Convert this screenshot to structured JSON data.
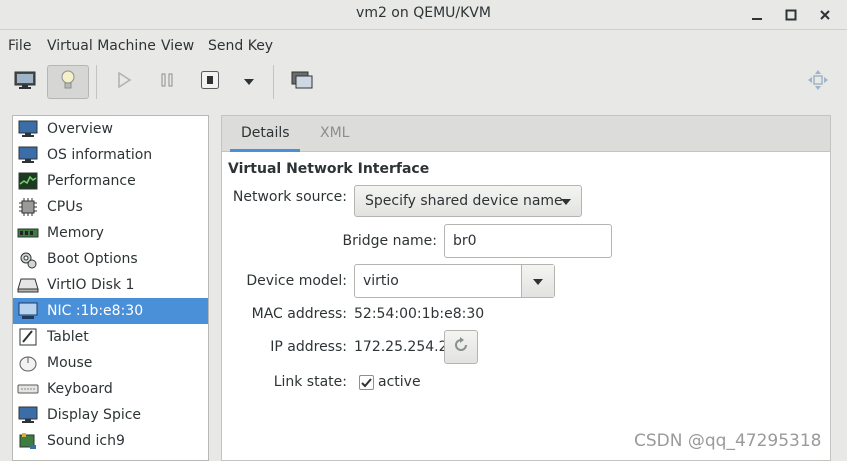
{
  "window": {
    "title": "vm2 on QEMU/KVM",
    "controls": [
      "minimize-icon",
      "maximize-icon",
      "close-icon"
    ]
  },
  "menubar": {
    "items": [
      "File",
      "Virtual Machine",
      "View",
      "Send Key"
    ]
  },
  "toolbar": {
    "buttons": [
      "monitor-icon",
      "lightbulb-icon",
      "play-icon",
      "pause-icon",
      "stop-icon",
      "chevron-down-icon",
      "screenshot-icon",
      "fullscreen-icon"
    ],
    "active": "lightbulb-icon"
  },
  "sidebar": {
    "items": [
      {
        "label": "Overview",
        "icon": "overview-icon"
      },
      {
        "label": "OS information",
        "icon": "os-info-icon"
      },
      {
        "label": "Performance",
        "icon": "performance-icon"
      },
      {
        "label": "CPUs",
        "icon": "cpu-icon"
      },
      {
        "label": "Memory",
        "icon": "memory-icon"
      },
      {
        "label": "Boot Options",
        "icon": "boot-options-icon"
      },
      {
        "label": "VirtIO Disk 1",
        "icon": "disk-icon"
      },
      {
        "label": "NIC :1b:e8:30",
        "icon": "nic-icon"
      },
      {
        "label": "Tablet",
        "icon": "tablet-icon"
      },
      {
        "label": "Mouse",
        "icon": "mouse-icon"
      },
      {
        "label": "Keyboard",
        "icon": "keyboard-icon"
      },
      {
        "label": "Display Spice",
        "icon": "display-icon"
      },
      {
        "label": "Sound ich9",
        "icon": "sound-icon"
      }
    ],
    "selected": "NIC :1b:e8:30"
  },
  "tabs": {
    "details": "Details",
    "xml": "XML",
    "active": "Details"
  },
  "nic": {
    "section_title": "Virtual Network Interface",
    "network_source_label": "Network source:",
    "network_source_value": "Specify shared device name",
    "bridge_name_label": "Bridge name:",
    "bridge_name_value": "br0",
    "device_model_label": "Device model:",
    "device_model_value": "virtio",
    "mac_label": "MAC address:",
    "mac_value": "52:54:00:1b:e8:30",
    "ip_label": "IP address:",
    "ip_value": "172.25.254.2",
    "link_state_label": "Link state:",
    "link_state_value": "active",
    "link_state_checked": true
  },
  "watermark": "CSDN @qq_47295318",
  "colors": {
    "accent": "#4a90d9",
    "background": "#e8e8e7"
  }
}
